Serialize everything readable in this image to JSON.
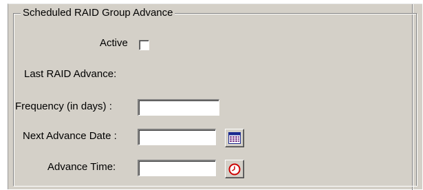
{
  "group": {
    "title": "Scheduled RAID Group Advance"
  },
  "fields": {
    "active_label": "Active",
    "last_advance_label": "Last RAID Advance:",
    "frequency_label": "Frequency (in days) :",
    "frequency_value": "",
    "next_date_label": "Next Advance Date :",
    "next_date_value": "",
    "advance_time_label": "Advance Time:",
    "advance_time_value": ""
  },
  "icons": {
    "calendar": "calendar-icon",
    "clock": "clock-icon"
  },
  "colors": {
    "panel_bg": "#d4d0c8",
    "calendar_accent": "#1b2a8f",
    "clock_accent": "#cc0000"
  }
}
